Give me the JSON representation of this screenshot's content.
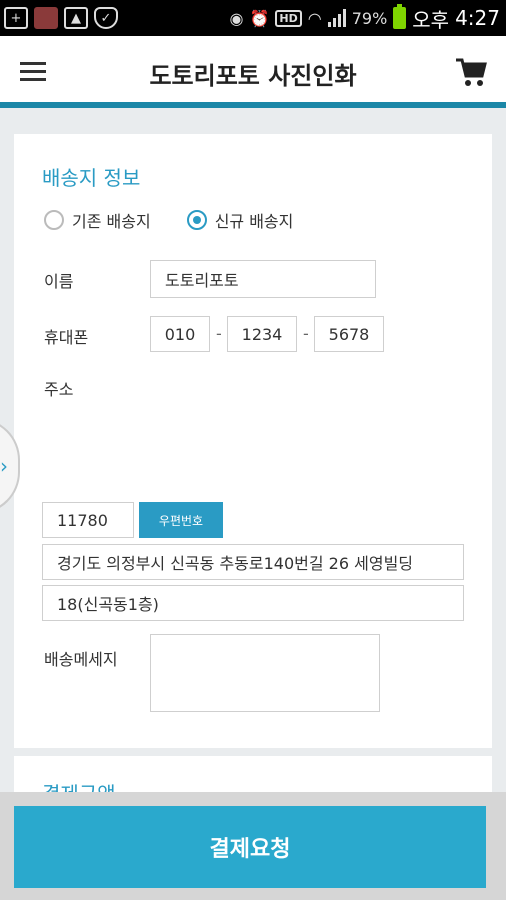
{
  "status_bar": {
    "battery": "79%",
    "ampm": "오후",
    "time": "4:27",
    "hd": "HD"
  },
  "header": {
    "title": "도토리포토 사진인화",
    "menu_icon": "hamburger-menu-icon",
    "cart_icon": "cart-icon"
  },
  "shipping": {
    "title": "배송지 정보",
    "options": [
      {
        "label": "기존 배송지",
        "selected": false
      },
      {
        "label": "신규 배송지",
        "selected": true
      }
    ],
    "name_label": "이름",
    "name_value": "도토리포토",
    "phone_label": "휴대폰",
    "phone": [
      "010",
      "1234",
      "5678"
    ],
    "phone_sep": "-",
    "address_label": "주소",
    "zipcode": "11780",
    "zip_button": "우편번호",
    "address1": "경기도 의정부시 신곡동 추동로140번길 26 세영빌딩",
    "address2": "18(신곡동1층)",
    "message_label": "배송메세지",
    "message_value": ""
  },
  "payment": {
    "title": "결제금액"
  },
  "pay_button": "결제요청",
  "colors": {
    "accent": "#2a9bc4",
    "header_border": "#1b87a7",
    "button": "#2aa9cd"
  }
}
